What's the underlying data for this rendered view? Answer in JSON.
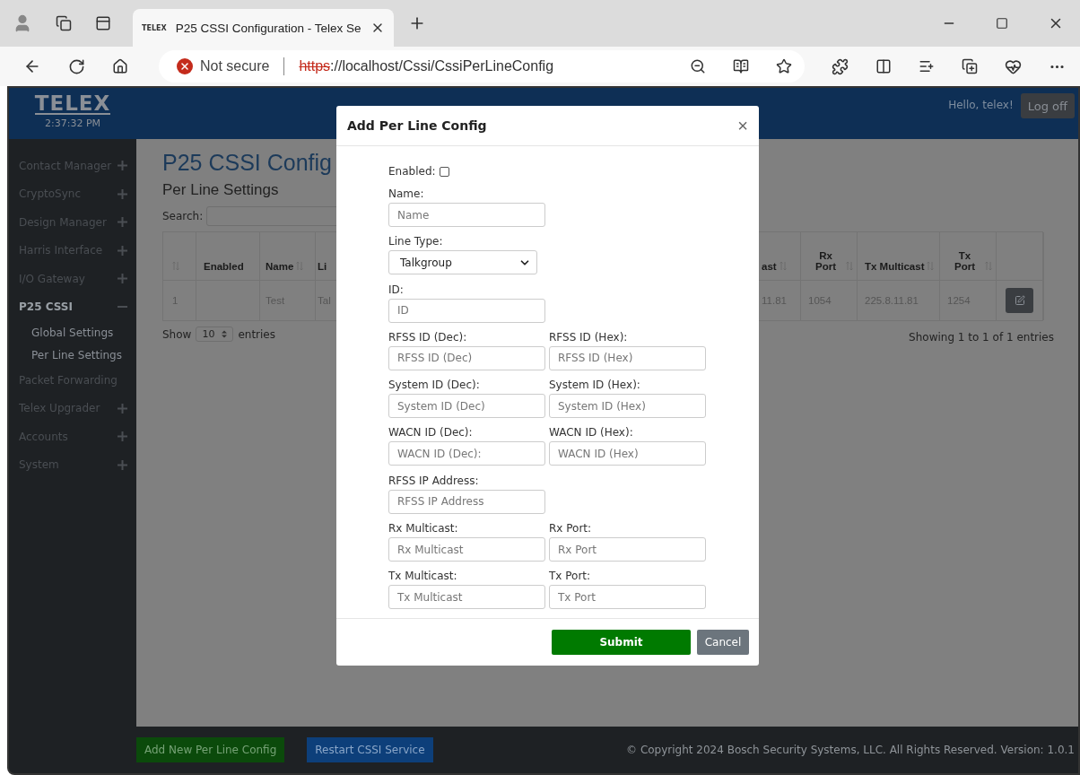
{
  "browser": {
    "tab": {
      "favicon": "TELEX",
      "title": "P25 CSSI Configuration - Telex Se"
    },
    "security": "Not secure",
    "url_scheme": "https",
    "url_rest": "://localhost/Cssi/CssiPerLineConfig"
  },
  "header": {
    "logo": "TELEX",
    "time": "2:37:32 PM",
    "greeting": "Hello, telex!",
    "logoff": "Log off"
  },
  "sidebar": {
    "items": [
      {
        "label": "Contact Manager",
        "expanded": false
      },
      {
        "label": "CryptoSync",
        "expanded": false
      },
      {
        "label": "Design Manager",
        "expanded": false
      },
      {
        "label": "Harris Interface",
        "expanded": false
      },
      {
        "label": "I/O Gateway",
        "expanded": false
      },
      {
        "label": "P25 CSSI",
        "expanded": true,
        "children": [
          {
            "label": "Global Settings"
          },
          {
            "label": "Per Line Settings"
          }
        ]
      },
      {
        "label": "Packet Forwarding"
      },
      {
        "label": "Telex Upgrader",
        "expanded": false
      },
      {
        "label": "Accounts",
        "expanded": false
      },
      {
        "label": "System",
        "expanded": false
      }
    ]
  },
  "page": {
    "title": "P25 CSSI Config",
    "subtitle": "Per Line Settings",
    "search_label": "Search:",
    "table": {
      "columns": [
        {
          "sortable": true
        },
        {
          "label": "Enabled",
          "sortable": false
        },
        {
          "label": "Name",
          "sortable": true
        },
        {
          "label": "Li"
        },
        {
          "label": "ast",
          "sortable": true
        },
        {
          "label": "Rx Port",
          "sortable": true
        },
        {
          "label": "Tx Multicast",
          "sortable": true
        },
        {
          "label": "Tx Port",
          "sortable": true
        },
        {
          "sortable": false
        }
      ],
      "rows": [
        {
          "cells": [
            "1",
            null,
            "Test",
            "Tal",
            "11.81",
            "1054",
            "225.8.11.81",
            "1254"
          ]
        }
      ]
    },
    "show_label": "Show",
    "page_size": "10",
    "entries_label": "entries",
    "info": "Showing 1 to 1 of 1 entries"
  },
  "footer": {
    "buttons": [
      {
        "label": "Add New Per Line Config",
        "kind": "add"
      },
      {
        "label": "Restart CSSI Service",
        "kind": "restart"
      }
    ],
    "copyright": "© Copyright 2024 Bosch Security Systems, LLC. All Rights Reserved. Version: 1.0.1"
  },
  "modal": {
    "title": "Add Per Line Config",
    "close": "×",
    "enabled": {
      "label": "Enabled:",
      "checked": false
    },
    "rows": [
      [
        {
          "kind": "input",
          "label": "Name:",
          "placeholder": "Name"
        }
      ],
      [
        {
          "kind": "select",
          "label": "Line Type:",
          "value": "Talkgroup"
        }
      ],
      [
        {
          "kind": "input",
          "label": "ID:",
          "placeholder": "ID"
        }
      ],
      [
        {
          "kind": "input",
          "label": "RFSS ID (Dec):",
          "placeholder": "RFSS ID (Dec)"
        },
        {
          "kind": "input",
          "label": "RFSS ID (Hex):",
          "placeholder": "RFSS ID (Hex)"
        }
      ],
      [
        {
          "kind": "input",
          "label": "System ID (Dec):",
          "placeholder": "System ID (Dec)"
        },
        {
          "kind": "input",
          "label": "System ID (Hex):",
          "placeholder": "System ID (Hex)"
        }
      ],
      [
        {
          "kind": "input",
          "label": "WACN ID (Dec):",
          "placeholder": "WACN ID (Dec):"
        },
        {
          "kind": "input",
          "label": "WACN ID (Hex):",
          "placeholder": "WACN ID (Hex)"
        }
      ],
      [
        {
          "kind": "input",
          "label": "RFSS IP Address:",
          "placeholder": "RFSS IP Address"
        }
      ],
      [
        {
          "kind": "input",
          "label": "Rx Multicast:",
          "placeholder": "Rx Multicast"
        },
        {
          "kind": "input",
          "label": "Rx Port:",
          "placeholder": "Rx Port"
        }
      ],
      [
        {
          "kind": "input",
          "label": "Tx Multicast:",
          "placeholder": "Tx Multicast"
        },
        {
          "kind": "input",
          "label": "Tx Port:",
          "placeholder": "Tx Port"
        }
      ]
    ],
    "submit": "Submit",
    "cancel": "Cancel"
  }
}
